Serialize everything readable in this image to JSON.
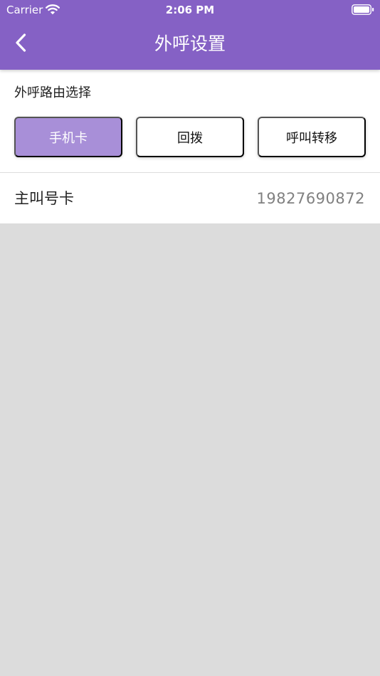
{
  "status_bar": {
    "carrier": "Carrier",
    "time": "2:06 PM",
    "wifi_icon": "wifi-icon",
    "battery_icon": "battery-icon"
  },
  "nav_bar": {
    "back_icon": "chevron-left-icon",
    "title": "外呼设置"
  },
  "outbound_routing": {
    "label": "外呼路由选择",
    "options": [
      {
        "label": "手机卡",
        "selected": true
      },
      {
        "label": "回拨",
        "selected": false
      },
      {
        "label": "呼叫转移",
        "selected": false
      }
    ]
  },
  "main_caller_card": {
    "label": "主叫号卡",
    "value": "19827690872"
  },
  "colors": {
    "header": "#8561c5",
    "selected_option": "#a88fd8",
    "content_background": "#ffffff",
    "page_background": "#dcdcdc",
    "value_text": "#808080"
  }
}
